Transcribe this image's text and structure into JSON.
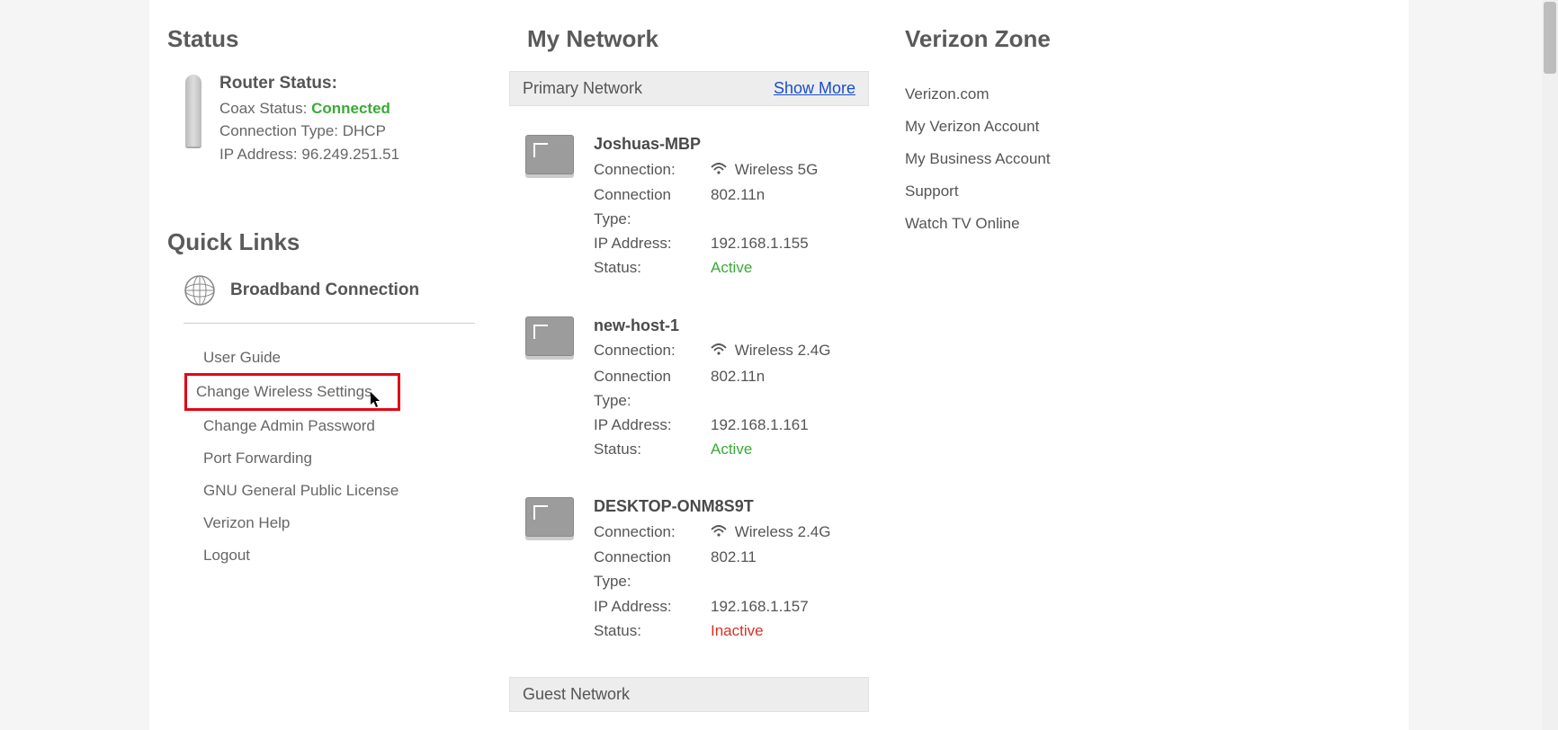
{
  "status": {
    "title": "Status",
    "router_status_label": "Router Status:",
    "coax_label": "Coax Status:",
    "coax_value": "Connected",
    "conn_type_label": "Connection Type:",
    "conn_type_value": "DHCP",
    "ip_label": "IP Address:",
    "ip_value": "96.249.251.51"
  },
  "quicklinks": {
    "title": "Quick Links",
    "broadband": "Broadband Connection",
    "items": [
      {
        "label": "User Guide"
      },
      {
        "label": "Change Wireless Settings",
        "highlight": true
      },
      {
        "label": "Change Admin Password"
      },
      {
        "label": "Port Forwarding"
      },
      {
        "label": "GNU General Public License"
      },
      {
        "label": "Verizon Help"
      },
      {
        "label": "Logout"
      }
    ]
  },
  "network": {
    "title": "My Network",
    "primary_label": "Primary Network",
    "show_more": "Show More",
    "guest_label": "Guest Network",
    "labels": {
      "connection": "Connection:",
      "conn_type": "Connection Type:",
      "ip": "IP Address:",
      "status": "Status:"
    },
    "devices": [
      {
        "name": "Joshuas-MBP",
        "connection": "Wireless 5G",
        "conn_type": "802.11n",
        "ip": "192.168.1.155",
        "status": "Active",
        "status_class": "active"
      },
      {
        "name": "new-host-1",
        "connection": "Wireless 2.4G",
        "conn_type": "802.11n",
        "ip": "192.168.1.161",
        "status": "Active",
        "status_class": "active"
      },
      {
        "name": "DESKTOP-ONM8S9T",
        "connection": "Wireless 2.4G",
        "conn_type": "802.11",
        "ip": "192.168.1.157",
        "status": "Inactive",
        "status_class": "inactive"
      }
    ]
  },
  "zone": {
    "title": "Verizon Zone",
    "items": [
      {
        "label": "Verizon.com"
      },
      {
        "label": "My Verizon Account"
      },
      {
        "label": "My Business Account"
      },
      {
        "label": "Support"
      },
      {
        "label": "Watch TV Online"
      }
    ]
  }
}
